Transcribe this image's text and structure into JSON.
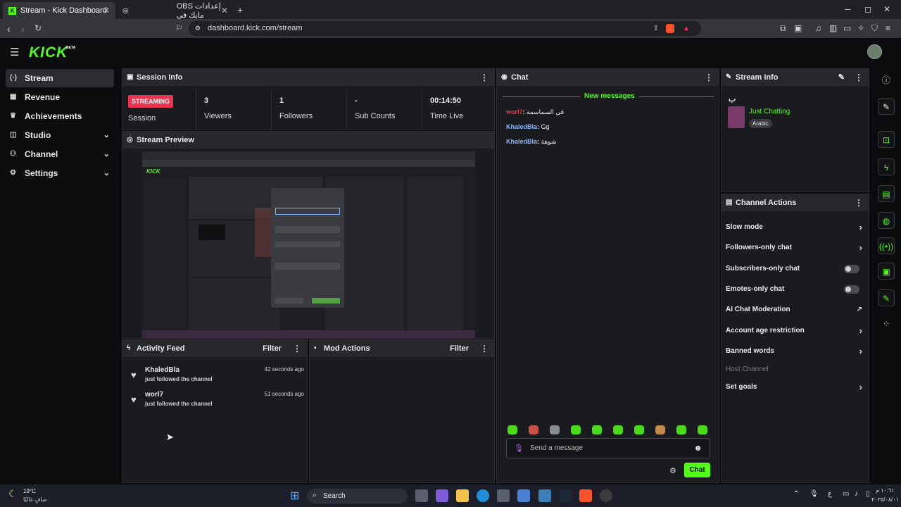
{
  "browser": {
    "tabs": [
      {
        "label": "Stream - Kick Dashboard",
        "close": "✕"
      },
      {
        "label": "OBS إعدادات مايك في",
        "close": "✕"
      }
    ],
    "new_tab": "+",
    "url": "dashboard.kick.com/stream",
    "window_controls": [
      "─",
      "◻",
      "✕"
    ]
  },
  "app": {
    "logo": "KICK",
    "logo_badge": "BETA",
    "accent": "#53fc18"
  },
  "sidebar": {
    "items": [
      {
        "label": "Stream",
        "icon": "stream-icon",
        "glyph": "(·)"
      },
      {
        "label": "Revenue",
        "icon": "revenue-icon",
        "glyph": "▦"
      },
      {
        "label": "Achievements",
        "icon": "trophy-icon",
        "glyph": "♛"
      },
      {
        "label": "Studio",
        "icon": "studio-icon",
        "glyph": "◫",
        "chevron": "⌄"
      },
      {
        "label": "Channel",
        "icon": "channel-icon",
        "glyph": "⚇",
        "chevron": "⌄"
      },
      {
        "label": "Settings",
        "icon": "settings-icon",
        "glyph": "⚙",
        "chevron": "⌄"
      }
    ]
  },
  "session": {
    "title": "Session Info",
    "badge": "STREAMING",
    "badge_label": "Session",
    "stats": [
      {
        "value": "3",
        "label": "Viewers"
      },
      {
        "value": "1",
        "label": "Followers"
      },
      {
        "value": "-",
        "label": "Sub Counts"
      },
      {
        "value": "00:14:50",
        "label": "Time Live"
      }
    ]
  },
  "preview": {
    "title": "Stream Preview"
  },
  "activity": {
    "title": "Activity Feed",
    "filter": "Filter",
    "items": [
      {
        "name": "KhaledBla",
        "text": "just followed the channel",
        "time": "42 seconds ago"
      },
      {
        "name": "worl7",
        "text": "just followed the channel",
        "time": "51 seconds ago"
      }
    ]
  },
  "mod": {
    "title": "Mod Actions",
    "filter": "Filter"
  },
  "chat": {
    "title": "Chat",
    "new_messages": "New messages",
    "messages": [
      {
        "user": "worl7",
        "text": "في السماسمة",
        "color": "#e9334f"
      },
      {
        "user": "KhaledBla",
        "text": "Gg",
        "color": "#8ab4f8"
      },
      {
        "user": "KhaledBla",
        "text": "شوهة",
        "color": "#8ab4f8"
      }
    ],
    "input_placeholder": "Send a message",
    "send_label": "Chat"
  },
  "stream_info": {
    "title": "Stream info",
    "stream_title": "ب",
    "category": "Just Chatting",
    "language": "Arabic"
  },
  "channel_actions": {
    "title": "Channel Actions",
    "items": [
      {
        "label": "Slow mode",
        "control": "chevron"
      },
      {
        "label": "Followers-only chat",
        "control": "chevron"
      },
      {
        "label": "Subscribers-only chat",
        "control": "toggle",
        "on": false
      },
      {
        "label": "Emotes-only chat",
        "control": "toggle",
        "on": false
      },
      {
        "label": "AI Chat Moderation",
        "control": "external"
      },
      {
        "label": "Account age restriction",
        "control": "chevron"
      },
      {
        "label": "Banned words",
        "control": "chevron"
      },
      {
        "label": "Host Channel",
        "control": "disabled"
      },
      {
        "label": "Set goals",
        "control": "chevron"
      }
    ]
  },
  "taskbar": {
    "weather_temp": "19°C",
    "weather_text": "صافٍ غالبًا",
    "search": "Search",
    "time": "١٠:٦١ م",
    "date": "٢٠٢٥/٠٨/٠١",
    "lang": "ع"
  }
}
